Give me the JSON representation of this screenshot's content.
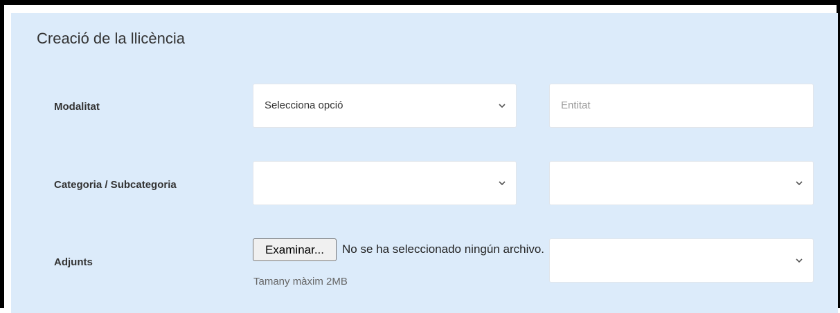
{
  "title": "Creació de la llicència",
  "rows": {
    "modalitat": {
      "label": "Modalitat",
      "select_value": "Selecciona opció",
      "entitat_placeholder": "Entitat"
    },
    "categoria": {
      "label": "Categoria / Subcategoria",
      "categoria_value": "",
      "subcategoria_value": ""
    },
    "adjunts": {
      "label": "Adjunts",
      "file_button": "Examinar...",
      "file_status": "No se ha seleccionado ningún archivo.",
      "hint": "Tamany màxim 2MB",
      "select_value": ""
    }
  },
  "icons": [
    "chevron-down-icon"
  ],
  "colors": {
    "panel_background": "#dcebfa",
    "field_background": "#ffffff",
    "frame_border": "#000000"
  }
}
